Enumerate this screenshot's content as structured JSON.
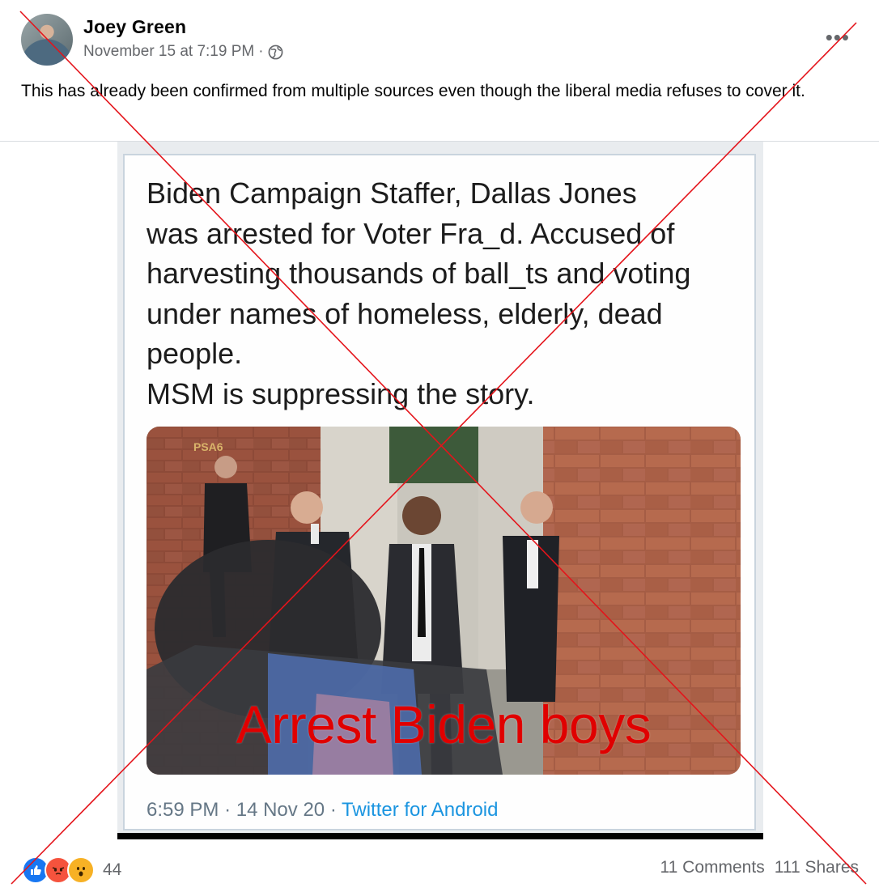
{
  "post": {
    "author": "Joey Green",
    "timestamp": "November 15 at 7:19 PM",
    "separator": "·",
    "privacy_icon": "globe-icon",
    "more_label": "•••",
    "text": "This has already been confirmed from multiple sources even though the liberal media refuses to cover it."
  },
  "tweet": {
    "text": "Biden Campaign Staffer, Dallas Jones\nwas arrested for Voter Fra_d. Accused of\nharvesting thousands of ball_ts and voting\nunder names of homeless, elderly, dead\npeople.\nMSM is suppressing the story.",
    "photo_caption": "Arrest Biden boys",
    "photo_sign": "PSA6",
    "time": "6:59 PM",
    "date": "14 Nov 20",
    "dot": "·",
    "source": "Twitter for Android"
  },
  "footer": {
    "reaction_icons": [
      "like-icon",
      "angry-icon",
      "wow-icon"
    ],
    "reaction_count": "44",
    "comments": "11 Comments",
    "shares": "111 Shares"
  },
  "colors": {
    "accent_blue": "#1877f2",
    "caption_red": "#e00000",
    "cross_red": "#e4141b",
    "meta_gray": "#65676b"
  }
}
